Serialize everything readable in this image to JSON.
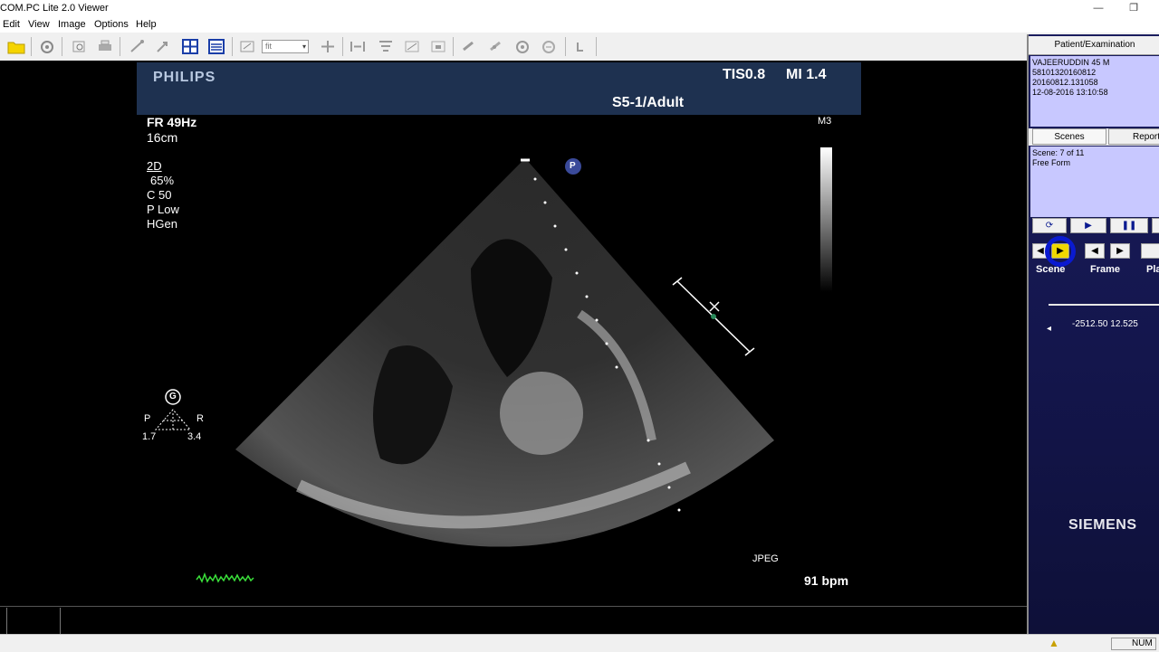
{
  "window": {
    "title": "COM.PC Lite 2.0 Viewer",
    "minimize_glyph": "—",
    "restore_glyph": "❐"
  },
  "menu": {
    "items": [
      "Edit",
      "View",
      "Image",
      "Options",
      "Help"
    ]
  },
  "toolbar": {
    "zoom_value": "fit",
    "icons": [
      "open-folder-icon",
      "settings-gear-icon",
      "zoom-window-icon",
      "print-icon",
      "measure-icon",
      "magnify-icon",
      "grid-layout-icon",
      "list-layout-icon",
      "rotate-icon",
      "pan-icon",
      "flip-icon",
      "filter-icon",
      "image-process-icon",
      "stamp-icon",
      "link-icon",
      "globe-icon",
      "target-icon",
      "hand-icon"
    ]
  },
  "ultrasound": {
    "vendor": "PHILIPS",
    "tis": "TIS0.8",
    "mi": "MI 1.4",
    "probe": "S5-1/Adult",
    "fr": "FR 49Hz",
    "depth": "16cm",
    "mode": "2D",
    "gain": "65%",
    "compress": "C 50",
    "power": "P Low",
    "harmonic": "HGen",
    "m3": "M3",
    "p_marker": "P",
    "g_marker": "G",
    "orient_p": "P",
    "orient_r": "R",
    "val_left": "1.7",
    "val_right": "3.4",
    "format": "JPEG",
    "heart_rate": "91 bpm"
  },
  "right_panel": {
    "header": "Patient/Examination",
    "patient_lines": [
      "VAJEERUDDIN 45 M",
      "58101320160812",
      "20160812.131058",
      "12-08-2016 13:10:58"
    ],
    "tabs": [
      "Scenes",
      "Reports"
    ],
    "scene_lines": [
      "Scene: 7 of 11",
      "Free Form"
    ],
    "nav_labels": [
      "Scene",
      "Frame",
      "Play"
    ],
    "slider_text": "-2512.50 12.525",
    "brand": "SIEMENS",
    "accent_color": "#c8c8ff",
    "panel_color": "#1a1d5e"
  },
  "status": {
    "num": "NUM"
  }
}
